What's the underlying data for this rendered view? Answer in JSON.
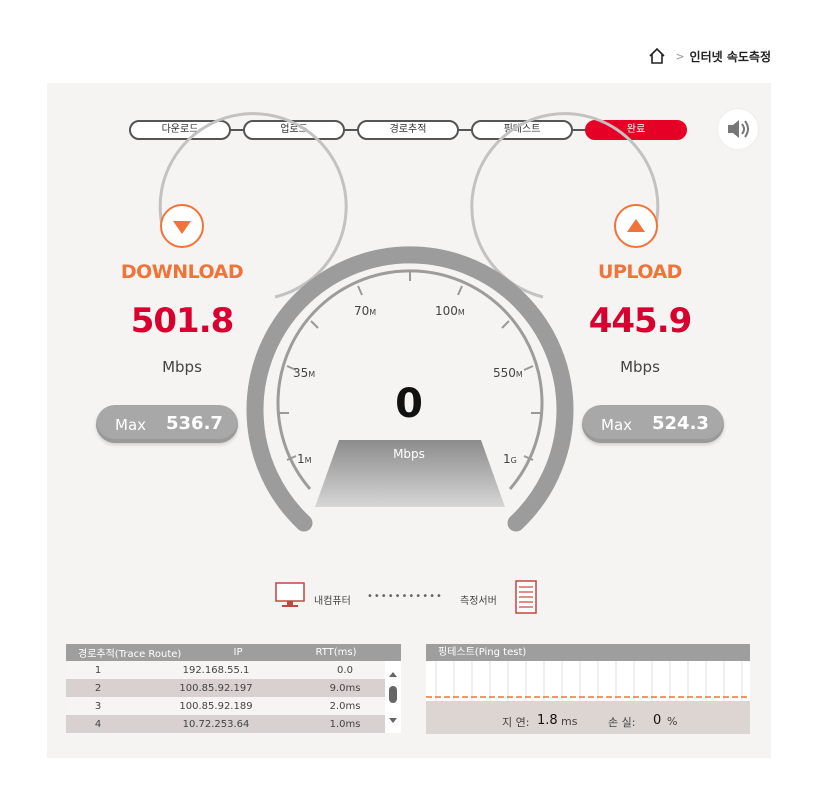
{
  "breadcrumb": {
    "separator": ">",
    "current": "인터넷 속도측정"
  },
  "steps": [
    "다운로드",
    "업로드",
    "경로추적",
    "핑테스트",
    "완료"
  ],
  "active_step": 4,
  "download": {
    "title": "DOWNLOAD",
    "value": "501.8",
    "unit": "Mbps",
    "max_label": "Max",
    "max_value": "536.7"
  },
  "upload": {
    "title": "UPLOAD",
    "value": "445.9",
    "unit": "Mbps",
    "max_label": "Max",
    "max_value": "524.3"
  },
  "gauge": {
    "value": "0",
    "unit": "Mbps",
    "ticks": [
      {
        "num": "1",
        "unit": "M"
      },
      {
        "num": "35",
        "unit": "M"
      },
      {
        "num": "70",
        "unit": "M"
      },
      {
        "num": "100",
        "unit": "M"
      },
      {
        "num": "550",
        "unit": "M"
      },
      {
        "num": "1",
        "unit": "G"
      }
    ]
  },
  "route": {
    "pc_label": "내컴퓨터",
    "dots": "•••••••••••",
    "server_label": "측정서버"
  },
  "trace": {
    "headers": [
      "경로추적(Trace Route)",
      "IP",
      "RTT(ms)"
    ],
    "rows": [
      [
        "1",
        "192.168.55.1",
        "0.0"
      ],
      [
        "2",
        "100.85.92.197",
        "9.0ms"
      ],
      [
        "3",
        "100.85.92.189",
        "2.0ms"
      ],
      [
        "4",
        "10.72.253.64",
        "1.0ms"
      ]
    ]
  },
  "ping": {
    "title": "핑테스트(Ping test)",
    "latency_label": "지 연:",
    "latency_value": "1.8",
    "latency_unit": "ms",
    "loss_label": "손 실:",
    "loss_value": "0",
    "loss_unit": "%"
  },
  "colors": {
    "accent": "#e60026",
    "orange": "#f07338",
    "value_red": "#d7002e",
    "gauge_gray": "#9c9c9c"
  },
  "icons": {
    "home": "home-icon",
    "sound": "speaker-icon",
    "pc": "monitor-icon",
    "server": "server-icon"
  }
}
